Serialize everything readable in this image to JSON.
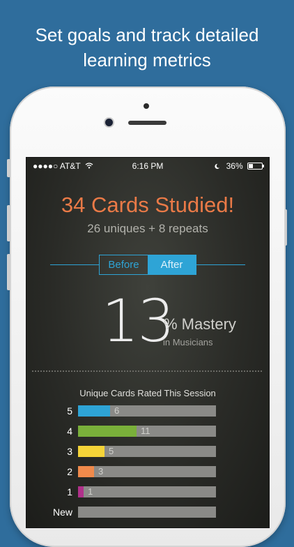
{
  "headline": [
    "Set goals and track detailed",
    "learning metrics"
  ],
  "status_bar": {
    "carrier": "●●●●○ AT&T",
    "wifi_icon": "wifi-icon",
    "time": "6:16 PM",
    "moon_icon": "moon-icon",
    "battery_percent": "36%",
    "battery_level": 0.36
  },
  "session": {
    "title": "34 Cards Studied!",
    "subtitle": "26 uniques + 8 repeats"
  },
  "toggle": {
    "before_label": "Before",
    "after_label": "After",
    "selected": "After"
  },
  "mastery": {
    "value": "13",
    "label": "% Mastery",
    "category": "in Musicians"
  },
  "ratings": {
    "title": "Unique Cards Rated This Session",
    "max": 26,
    "rows": [
      {
        "label": "5",
        "count": 6,
        "count_text": "6",
        "color": "#2ea4d6"
      },
      {
        "label": "4",
        "count": 11,
        "count_text": "11",
        "color": "#7ab03a"
      },
      {
        "label": "3",
        "count": 5,
        "count_text": "5",
        "color": "#f5d438"
      },
      {
        "label": "2",
        "count": 3,
        "count_text": "3",
        "color": "#f08a4b"
      },
      {
        "label": "1",
        "count": 1,
        "count_text": "1",
        "color": "#b0308a"
      },
      {
        "label": "New",
        "count": 0,
        "count_text": "",
        "color": "#8a8a87"
      }
    ]
  },
  "colors": {
    "background": "#2f6d9c",
    "accent": "#2ea4d6",
    "title_orange": "#ea7a47"
  }
}
